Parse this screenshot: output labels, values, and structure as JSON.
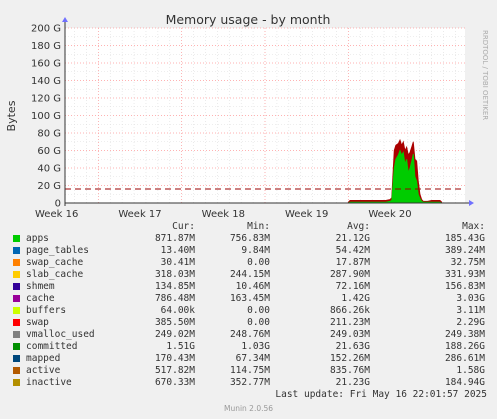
{
  "chart_data": {
    "type": "area",
    "title": "Memory usage - by month",
    "ylabel": "Bytes",
    "side_text": "RRDTOOL / TOBI OETIKER",
    "ylim": [
      0,
      200
    ],
    "y_unit": "G",
    "y_ticks": [
      "0",
      "20 G",
      "40 G",
      "60 G",
      "80 G",
      "100 G",
      "120 G",
      "140 G",
      "160 G",
      "180 G",
      "200 G"
    ],
    "x_ticks": [
      "Week 16",
      "Week 17",
      "Week 18",
      "Week 19",
      "Week 20"
    ],
    "x_weeks": [
      15.6,
      20.4
    ],
    "grid": true,
    "reference_line": {
      "value": 16,
      "color": "#990000",
      "style": "dashed"
    },
    "series": [
      {
        "name": "apps",
        "color": "#00cc00",
        "points": [
          [
            19.0,
            0
          ],
          [
            19.02,
            1
          ],
          [
            19.45,
            1
          ],
          [
            19.5,
            2
          ],
          [
            19.52,
            3
          ],
          [
            19.55,
            40
          ],
          [
            19.57,
            50
          ],
          [
            19.6,
            55
          ],
          [
            19.62,
            60
          ],
          [
            19.64,
            55
          ],
          [
            19.66,
            58
          ],
          [
            19.68,
            45
          ],
          [
            19.7,
            50
          ],
          [
            19.72,
            35
          ],
          [
            19.74,
            40
          ],
          [
            19.76,
            48
          ],
          [
            19.78,
            56
          ],
          [
            19.8,
            30
          ],
          [
            19.82,
            25
          ],
          [
            19.84,
            10
          ],
          [
            19.86,
            5
          ],
          [
            19.88,
            2
          ],
          [
            19.9,
            1
          ],
          [
            19.95,
            1
          ],
          [
            20.0,
            1
          ],
          [
            20.05,
            1
          ],
          [
            20.1,
            1
          ],
          [
            20.12,
            0
          ]
        ]
      },
      {
        "name": "inactive",
        "color": "#aa0000",
        "points": [
          [
            19.0,
            1
          ],
          [
            19.02,
            3
          ],
          [
            19.45,
            3
          ],
          [
            19.5,
            4
          ],
          [
            19.52,
            6
          ],
          [
            19.55,
            60
          ],
          [
            19.57,
            66
          ],
          [
            19.6,
            68
          ],
          [
            19.62,
            72
          ],
          [
            19.64,
            66
          ],
          [
            19.66,
            70
          ],
          [
            19.68,
            60
          ],
          [
            19.7,
            64
          ],
          [
            19.72,
            55
          ],
          [
            19.74,
            58
          ],
          [
            19.76,
            64
          ],
          [
            19.78,
            70
          ],
          [
            19.8,
            50
          ],
          [
            19.82,
            48
          ],
          [
            19.84,
            25
          ],
          [
            19.86,
            10
          ],
          [
            19.88,
            4
          ],
          [
            19.9,
            2
          ],
          [
            19.95,
            2
          ],
          [
            20.0,
            3
          ],
          [
            20.05,
            3
          ],
          [
            20.1,
            3
          ],
          [
            20.12,
            1
          ]
        ]
      }
    ],
    "legend": {
      "headers": [
        "Cur:",
        "Min:",
        "Avg:",
        "Max:"
      ],
      "rows": [
        {
          "name": "apps",
          "color": "#00cc00",
          "cur": "871.87M",
          "min": "756.83M",
          "avg": "21.12G",
          "max": "185.43G"
        },
        {
          "name": "page_tables",
          "color": "#0066b3",
          "cur": "13.40M",
          "min": "9.84M",
          "avg": "54.42M",
          "max": "389.24M"
        },
        {
          "name": "swap_cache",
          "color": "#ff8000",
          "cur": "30.41M",
          "min": "0.00",
          "avg": "17.87M",
          "max": "32.75M"
        },
        {
          "name": "slab_cache",
          "color": "#ffcc00",
          "cur": "318.03M",
          "min": "244.15M",
          "avg": "287.90M",
          "max": "331.93M"
        },
        {
          "name": "shmem",
          "color": "#330099",
          "cur": "134.85M",
          "min": "10.46M",
          "avg": "72.16M",
          "max": "156.83M"
        },
        {
          "name": "cache",
          "color": "#990099",
          "cur": "786.48M",
          "min": "163.45M",
          "avg": "1.42G",
          "max": "3.03G"
        },
        {
          "name": "buffers",
          "color": "#ccff00",
          "cur": "64.00k",
          "min": "0.00",
          "avg": "866.26k",
          "max": "3.11M"
        },
        {
          "name": "swap",
          "color": "#ff0000",
          "cur": "385.50M",
          "min": "0.00",
          "avg": "211.23M",
          "max": "2.29G"
        },
        {
          "name": "vmalloc_used",
          "color": "#808080",
          "cur": "249.02M",
          "min": "248.76M",
          "avg": "249.03M",
          "max": "249.38M"
        },
        {
          "name": "committed",
          "color": "#008f00",
          "cur": "1.51G",
          "min": "1.03G",
          "avg": "21.63G",
          "max": "188.26G"
        },
        {
          "name": "mapped",
          "color": "#00487d",
          "cur": "170.43M",
          "min": "67.34M",
          "avg": "152.26M",
          "max": "286.61M"
        },
        {
          "name": "active",
          "color": "#b35a00",
          "cur": "517.82M",
          "min": "114.75M",
          "avg": "835.76M",
          "max": "1.58G"
        },
        {
          "name": "inactive",
          "color": "#b38f00",
          "cur": "670.33M",
          "min": "352.77M",
          "avg": "21.23G",
          "max": "184.94G"
        }
      ]
    }
  },
  "last_update": "Last update: Fri May 16 22:01:57 2025",
  "footer": "Munin 2.0.56"
}
